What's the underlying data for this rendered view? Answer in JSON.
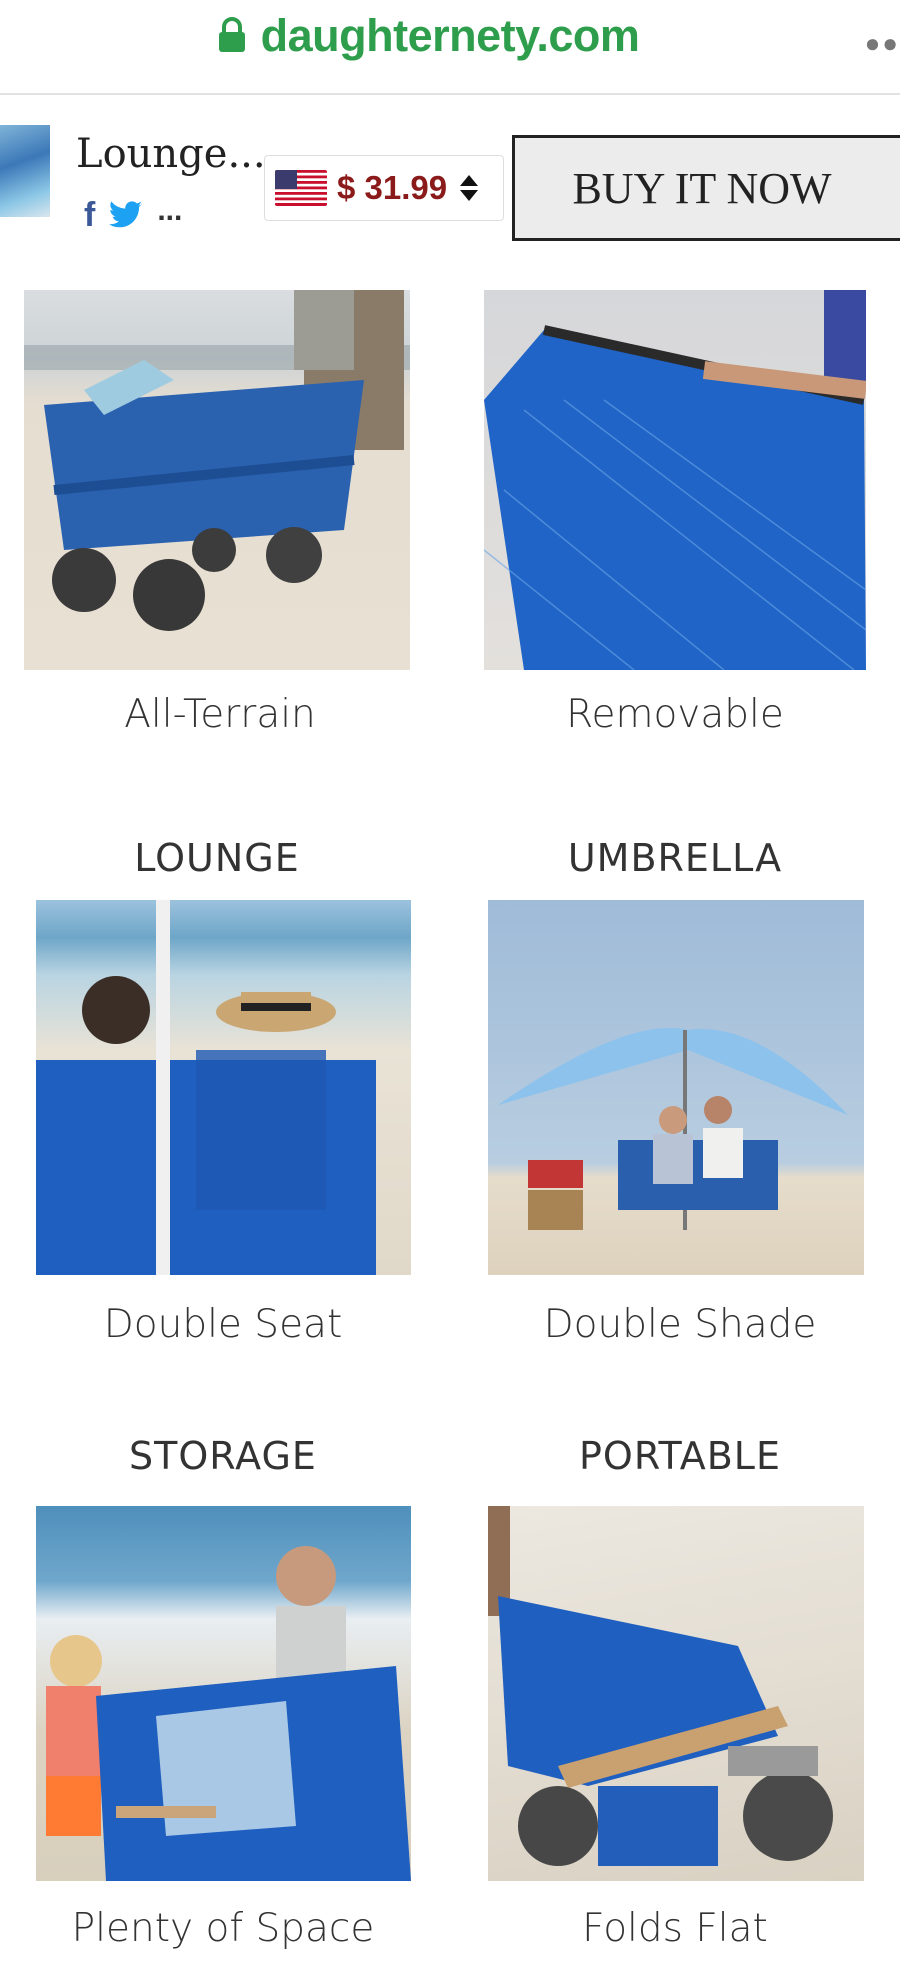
{
  "browser": {
    "url": "daughternety.com",
    "menu_icon": "more-dots-icon"
  },
  "product_bar": {
    "title": "Lounge...",
    "social_icons": [
      "facebook-icon",
      "twitter-icon"
    ],
    "more_label": "...",
    "currency_flag": "us-flag-icon",
    "price": "$ 31.99",
    "buy_label": "BUY IT NOW",
    "colors": {
      "price": "#8b1a1a",
      "url": "#2e9e4d"
    }
  },
  "features": [
    {
      "caption": "All-Terrain",
      "image": "wagon on sand with wheels"
    },
    {
      "caption": "Removable",
      "image": "blue mesh basket"
    }
  ],
  "sections": [
    {
      "heading": "LOUNGE",
      "caption": "Double Seat"
    },
    {
      "heading": "UMBRELLA",
      "caption": "Double Shade"
    },
    {
      "heading": "STORAGE",
      "caption": "Plenty of Space"
    },
    {
      "heading": "PORTABLE",
      "caption": "Folds Flat"
    }
  ]
}
